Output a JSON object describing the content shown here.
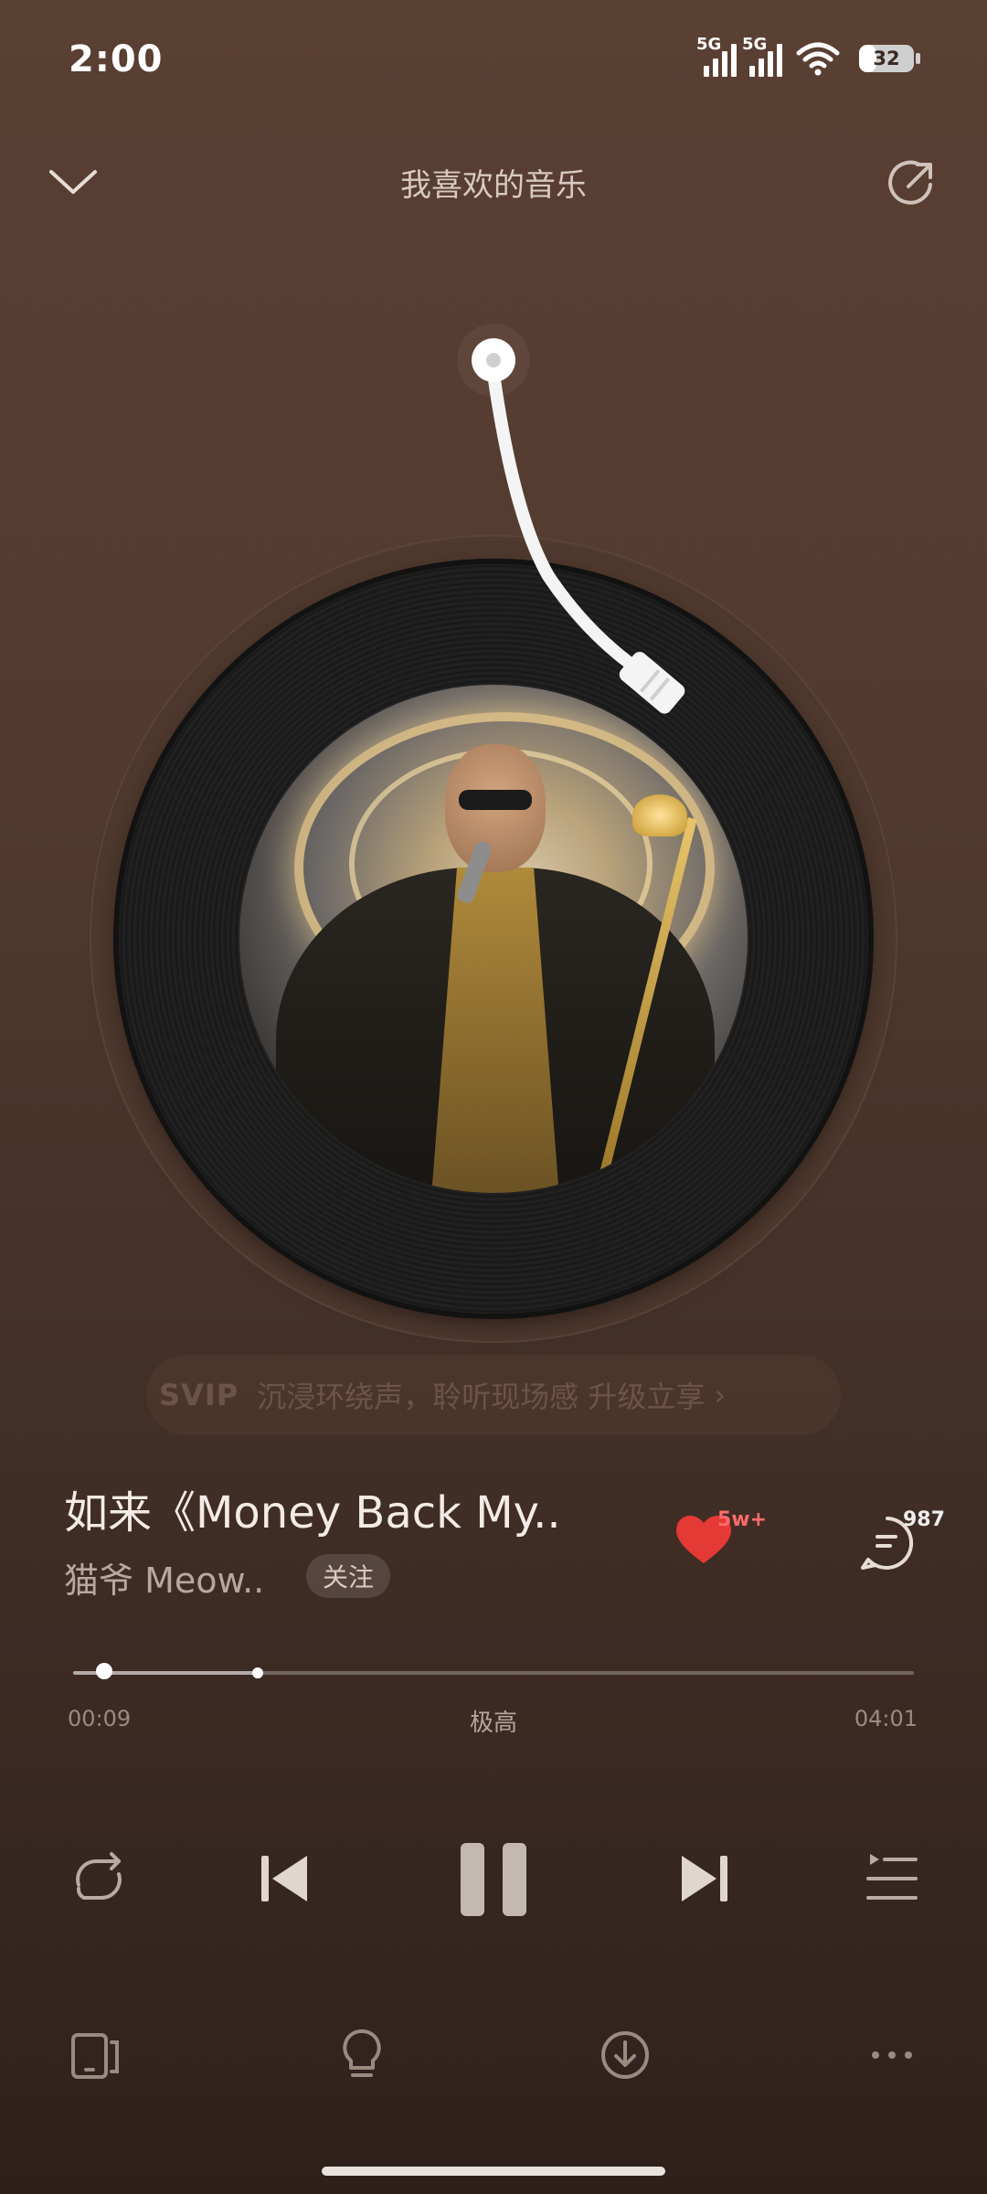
{
  "status_bar": {
    "time": "2:00",
    "network_labels": [
      "5G",
      "5G"
    ],
    "battery": "32",
    "battery_level": 0.32
  },
  "header": {
    "title": "我喜欢的音乐",
    "back_icon": "chevron-down-icon",
    "share_icon": "share-icon"
  },
  "player": {
    "svip_tag": "SVIP",
    "svip_text": "沉浸环绕声，聆听现场感  升级立享",
    "song_title": "如来《Money Back My..",
    "artist": "猫爷 Meow..",
    "follow_label": "关注",
    "like_count": "5w+",
    "comment_count": "987",
    "current_time": "00:09",
    "total_time": "04:01",
    "quality": "极高",
    "progress": 0.037,
    "buffered": 0.22
  },
  "colors": {
    "background_top": "#5a3f33",
    "background_bottom": "#2e211c",
    "like": "#e53935",
    "accent_text": "#f3ebe6"
  },
  "controls": {
    "repeat_icon": "repeat-icon",
    "prev_icon": "skip-previous-icon",
    "play_pause_icon": "pause-icon",
    "next_icon": "skip-next-icon",
    "playlist_icon": "playlist-icon"
  },
  "bottom_bar": {
    "icons": [
      "device-cast-icon",
      "lightbulb-icon",
      "download-icon",
      "more-icon"
    ]
  }
}
